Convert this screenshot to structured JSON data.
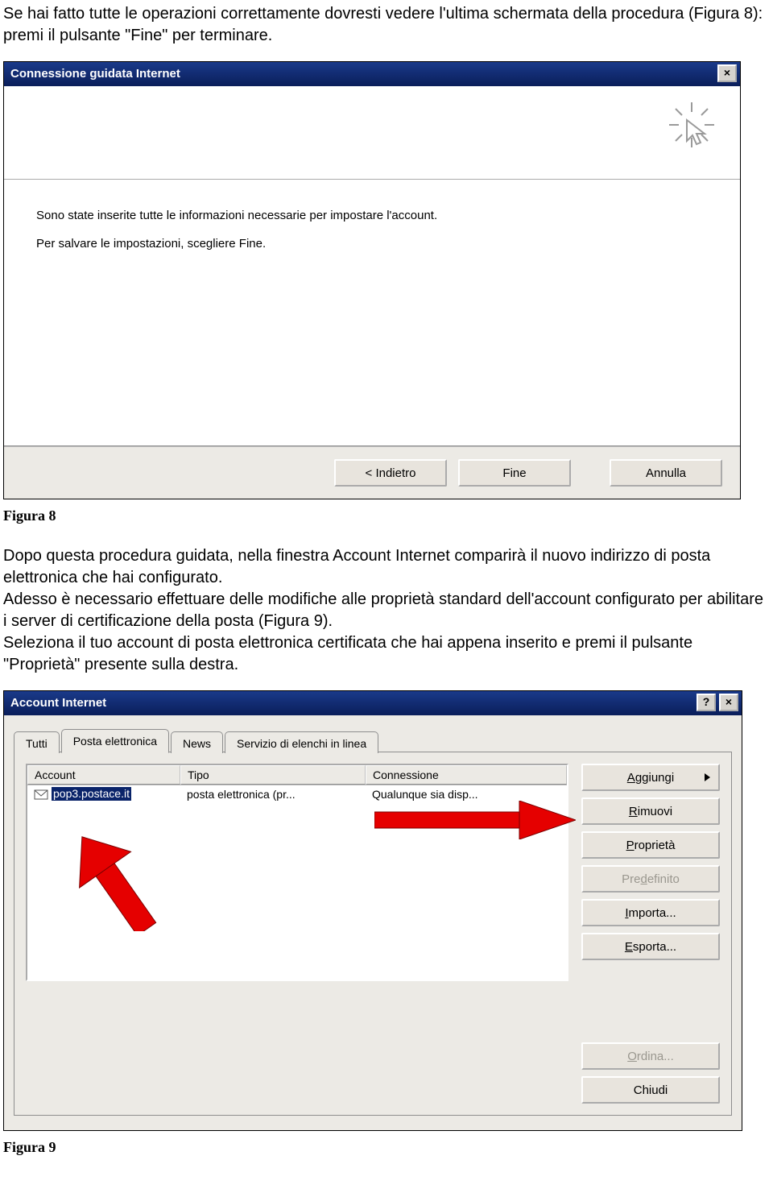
{
  "intro": {
    "p1": "Se hai fatto tutte le operazioni correttamente dovresti vedere l'ultima schermata della procedura (Figura 8): premi il pulsante \"Fine\" per terminare."
  },
  "wizard": {
    "title": "Connessione guidata Internet",
    "line1": "Sono state inserite tutte le informazioni necessarie per impostare l'account.",
    "line2": "Per salvare le impostazioni, scegliere Fine.",
    "btn_back": "< Indietro",
    "btn_finish": "Fine",
    "btn_cancel": "Annulla"
  },
  "caption8": "Figura 8",
  "mid": {
    "p1": "Dopo questa procedura guidata, nella finestra Account Internet comparirà il nuovo indirizzo di posta elettronica che hai configurato.",
    "p2": "Adesso è necessario effettuare delle modifiche alle proprietà standard dell'account configurato per abilitare i server di certificazione della posta (Figura 9).",
    "p3": "Seleziona il tuo account di posta elettronica certificata che hai appena inserito e premi il pulsante \"Proprietà\" presente sulla destra."
  },
  "acct": {
    "title": "Account Internet",
    "tabs": {
      "all": "Tutti",
      "mail": "Posta elettronica",
      "news": "News",
      "dir": "Servizio di elenchi in linea"
    },
    "cols": {
      "account": "Account",
      "tipo": "Tipo",
      "conn": "Connessione"
    },
    "row": {
      "account": "pop3.postace.it",
      "tipo": "posta elettronica (pr...",
      "conn": "Qualunque sia disp..."
    },
    "btns": {
      "add": "Aggiungi",
      "remove": "Rimuovi",
      "props": "Proprietà",
      "default": "Predefinito",
      "import": "Importa...",
      "export": "Esporta...",
      "order": "Ordina...",
      "close": "Chiudi"
    }
  },
  "caption9": "Figura 9"
}
